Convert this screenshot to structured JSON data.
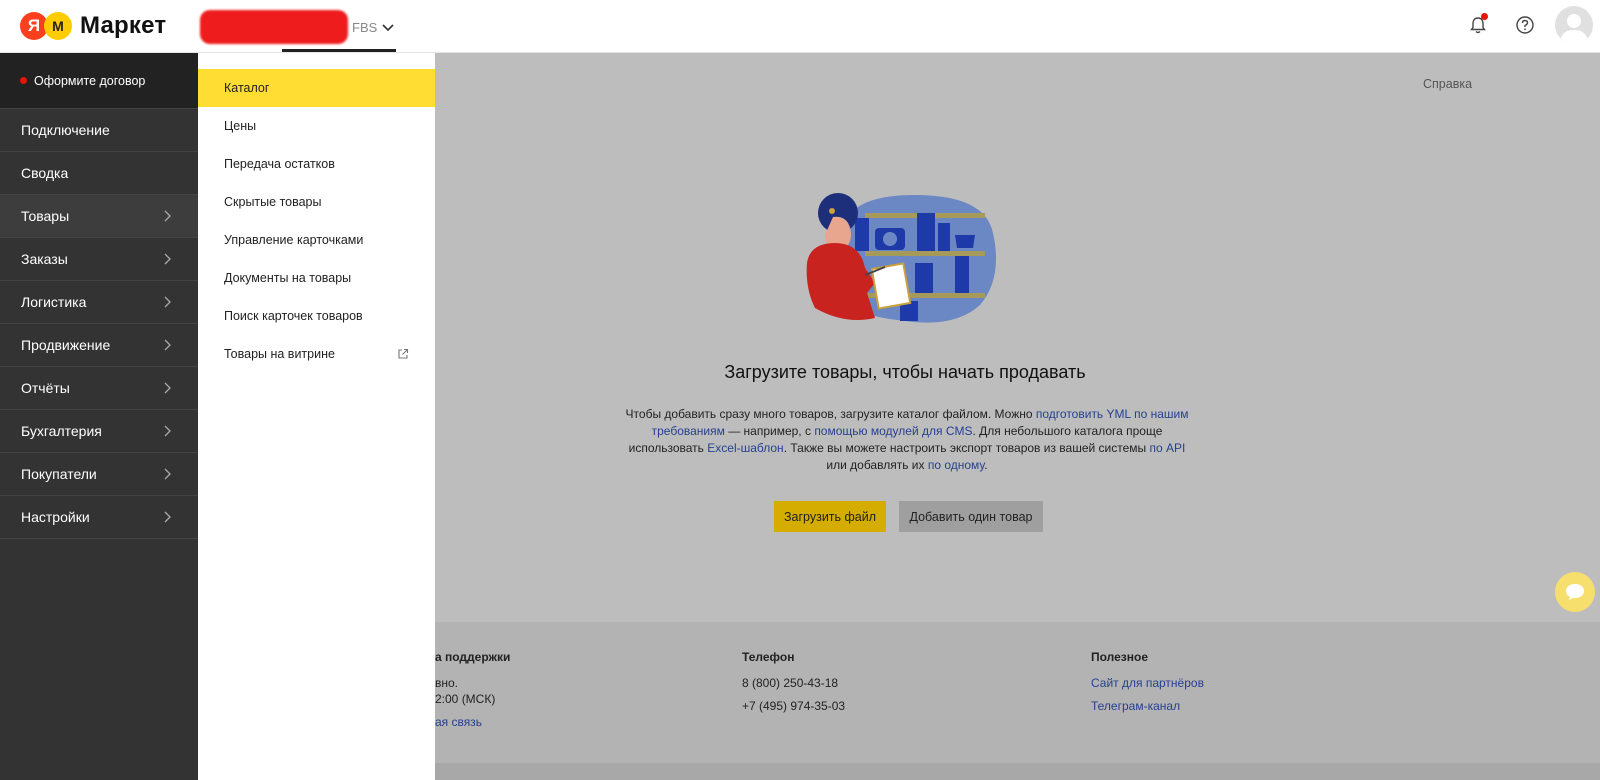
{
  "header": {
    "logo_badge": "Я",
    "logo_badge2": "M",
    "logo_text": "Маркет",
    "shop_label": "FBS"
  },
  "sidebar": {
    "contract_label": "Оформите договор",
    "items": [
      {
        "label": "Подключение"
      },
      {
        "label": "Сводка"
      },
      {
        "label": "Товары"
      },
      {
        "label": "Заказы"
      },
      {
        "label": "Логистика"
      },
      {
        "label": "Продвижение"
      },
      {
        "label": "Отчёты"
      },
      {
        "label": "Бухгалтерия"
      },
      {
        "label": "Покупатели"
      },
      {
        "label": "Настройки"
      }
    ]
  },
  "submenu": {
    "items": [
      {
        "label": "Каталог"
      },
      {
        "label": "Цены"
      },
      {
        "label": "Передача остатков"
      },
      {
        "label": "Скрытые товары"
      },
      {
        "label": "Управление карточками"
      },
      {
        "label": "Документы на товары"
      },
      {
        "label": "Поиск карточек товаров"
      },
      {
        "label": "Товары на витрине"
      }
    ]
  },
  "main": {
    "help_link": "Справка",
    "title": "Загрузите товары, чтобы начать продавать",
    "desc": {
      "t1": "Чтобы добавить сразу много товаров, загрузите каталог файлом. Можно ",
      "l1": "подготовить YML по нашим требованиям",
      "t2": " — например, с ",
      "l2": "помощью модулей для CMS",
      "t3": ". Для небольшого каталога проще использовать ",
      "l3": "Excel-шаблон",
      "t4": ". Также вы можете настроить экспорт товаров из вашей системы ",
      "l4": "по API",
      "t5": " или добавлять их ",
      "l5": "по одному",
      "t6": "."
    },
    "upload_button": "Загрузить файл",
    "add_button": "Добавить один товар"
  },
  "footer": {
    "support": {
      "head": "а поддержки",
      "line1": "вно.",
      "line2": "2:00 (МСК)",
      "link": "ая связь"
    },
    "phone": {
      "head": "Телефон",
      "phone1": "8 (800) 250-43-18",
      "phone2": "+7 (495) 974-35-03"
    },
    "useful": {
      "head": "Полезное",
      "link1": "Сайт для партнёров",
      "link2": "Телеграм-канал"
    }
  }
}
